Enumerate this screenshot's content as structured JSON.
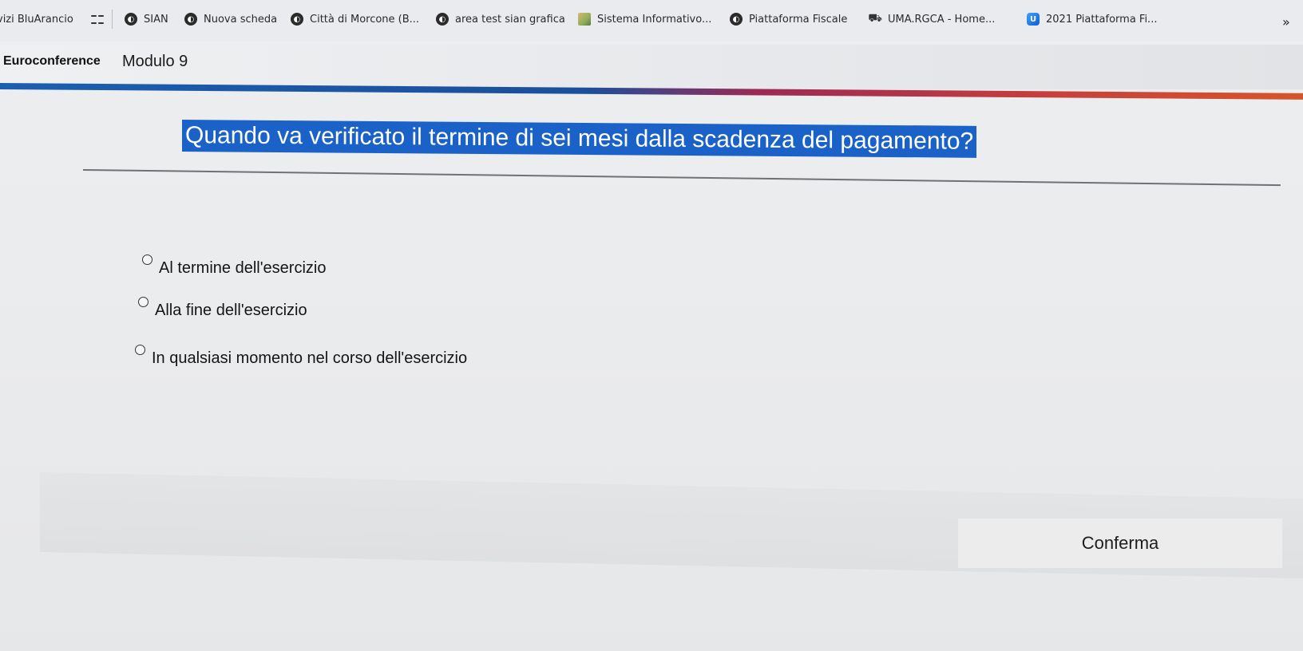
{
  "bookmarks": {
    "items": [
      {
        "label": "vizi BluArancio",
        "icon": "none"
      },
      {
        "label": "SIAN",
        "icon": "globe-icon"
      },
      {
        "label": "Nuova scheda",
        "icon": "globe-icon"
      },
      {
        "label": "Città di Morcone (B...",
        "icon": "globe-icon"
      },
      {
        "label": "area test sian grafica",
        "icon": "globe-icon"
      },
      {
        "label": "Sistema Informativo...",
        "icon": "image-icon"
      },
      {
        "label": "Piattaforma Fiscale",
        "icon": "globe-icon"
      },
      {
        "label": "UMA.RGCA - Home...",
        "icon": "tractor-icon"
      },
      {
        "label": "2021 Piattaforma Fi...",
        "icon": "u-logo-icon"
      }
    ],
    "more_label": "»"
  },
  "header": {
    "brand": "Euroconference",
    "module": "Modulo 9"
  },
  "quiz": {
    "question": "Quando va verificato il termine di sei mesi dalla scadenza del pagamento?",
    "answers": [
      "Al termine dell'esercizio",
      "Alla fine dell'esercizio",
      "In qualsiasi momento nel corso dell'esercizio"
    ],
    "confirm_label": "Conferma"
  },
  "colors": {
    "question_bg": "#1a62c8",
    "accent_blue": "#1b5fb0",
    "accent_red": "#c9413a"
  }
}
